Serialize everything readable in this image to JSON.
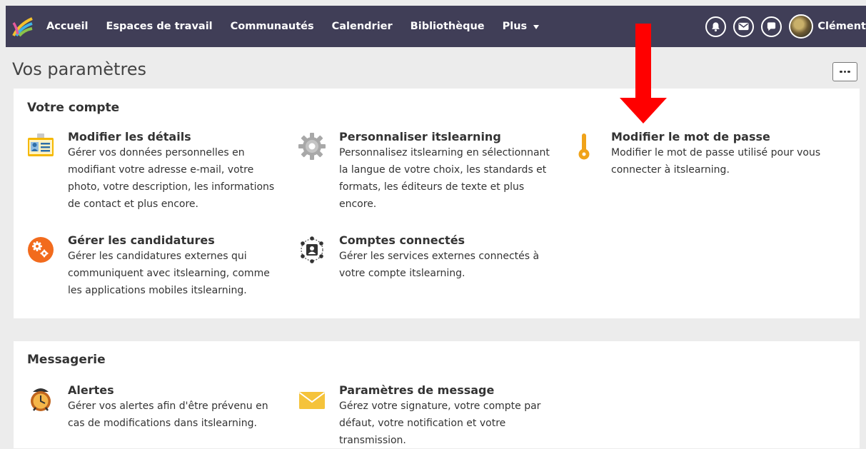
{
  "nav": {
    "items": [
      "Accueil",
      "Espaces de travail",
      "Communautés",
      "Calendrier",
      "Bibliothèque"
    ],
    "more_label": "Plus",
    "user_name": "Clément"
  },
  "page": {
    "title": "Vos paramètres"
  },
  "account_section": {
    "title": "Votre compte",
    "items": [
      {
        "title": "Modifier les détails",
        "desc_lines": [
          "Gérer vos données personnelles en",
          "modifiant votre adresse e-mail, votre",
          "photo, votre description, les informations",
          "de contact et plus encore."
        ]
      },
      {
        "title": "Personnaliser itslearning",
        "desc_lines": [
          "Personnalisez itslearning en sélectionnant",
          "la langue de votre choix, les standards et",
          "formats, les éditeurs de texte et plus",
          "encore."
        ]
      },
      {
        "title": "Modifier le mot de passe",
        "desc_lines": [
          "Modifier le mot de passe utilisé pour vous",
          "connecter à itslearning."
        ]
      },
      {
        "title": "Gérer les candidatures",
        "desc_lines": [
          "Gérer les candidatures externes qui",
          "communiquent avec itslearning, comme",
          "les applications mobiles itslearning."
        ]
      },
      {
        "title": "Comptes connectés",
        "desc_lines": [
          "Gérer les services externes connectés à",
          "votre compte itslearning."
        ]
      }
    ]
  },
  "messaging_section": {
    "title": "Messagerie",
    "items": [
      {
        "title": "Alertes",
        "desc_lines": [
          "Gérer vos alertes afin d'être prévenu en",
          "cas de modifications dans itslearning."
        ]
      },
      {
        "title": "Paramètres de message",
        "desc_lines": [
          "Gérez votre signature, votre compte par",
          "défaut, votre notification et votre",
          "transmission."
        ]
      }
    ]
  },
  "icons": {
    "nav": [
      "bell-icon",
      "mail-icon",
      "chat-icon"
    ],
    "items": [
      "id-card-icon",
      "gear-icon",
      "thermometer-icon",
      "cogs-icon",
      "connected-accounts-icon",
      "alarm-clock-icon",
      "envelope-icon"
    ]
  },
  "colors": {
    "topbar": "#403e57",
    "background": "#ececec",
    "panel": "#ffffff",
    "arrow": "#ff0000",
    "orange": "#f26b1d",
    "envelope": "#f5c33b"
  }
}
